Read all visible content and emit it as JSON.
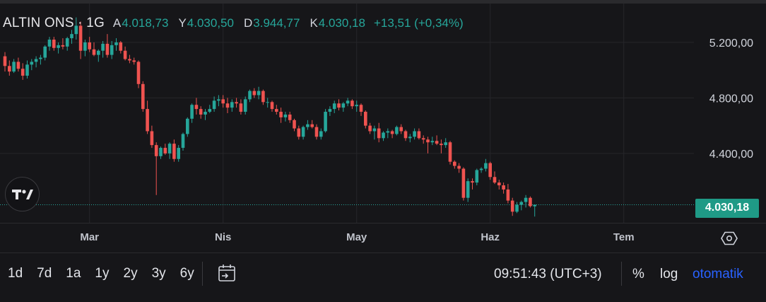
{
  "legend": {
    "symbol": "ALTIN ONS · 1G",
    "open_label": "A",
    "open_value": "4.018,73",
    "high_label": "Y",
    "high_value": "4.030,50",
    "low_label": "D",
    "low_value": "3.944,77",
    "close_label": "K",
    "close_value": "4.030,18",
    "change": "+13,51 (+0,34%)"
  },
  "price_badge": "4.030,18",
  "colors": {
    "up": "#26a69a",
    "down": "#ef5350",
    "badge": "#1f9a86",
    "auto": "#2962ff"
  },
  "chart_data": {
    "type": "candlestick",
    "ylim": [
      3900,
      5480
    ],
    "y_ticks": [
      {
        "value": 5200,
        "label": "5.200,00"
      },
      {
        "value": 4800,
        "label": "4.800,00"
      },
      {
        "value": 4400,
        "label": "4.400,00"
      }
    ],
    "x_ticks": [
      "Mar",
      "Nis",
      "May",
      "Haz",
      "Tem"
    ],
    "x_tick_index": [
      19,
      49,
      79,
      109,
      139
    ],
    "last_price": 4030.18,
    "ohlc": [
      [
        5100,
        5130,
        4990,
        5030
      ],
      [
        5030,
        5070,
        4960,
        4990
      ],
      [
        4990,
        5080,
        4980,
        5060
      ],
      [
        5060,
        5090,
        4990,
        5010
      ],
      [
        5010,
        5050,
        4930,
        4960
      ],
      [
        4960,
        5070,
        4940,
        5040
      ],
      [
        5040,
        5080,
        5000,
        5060
      ],
      [
        5060,
        5100,
        5020,
        5080
      ],
      [
        5080,
        5110,
        5040,
        5090
      ],
      [
        5090,
        5180,
        5070,
        5170
      ],
      [
        5170,
        5240,
        5140,
        5220
      ],
      [
        5220,
        5240,
        5140,
        5160
      ],
      [
        5160,
        5200,
        5120,
        5180
      ],
      [
        5180,
        5230,
        5150,
        5170
      ],
      [
        5170,
        5240,
        5140,
        5230
      ],
      [
        5230,
        5290,
        5190,
        5260
      ],
      [
        5260,
        5380,
        5220,
        5320
      ],
      [
        5320,
        5350,
        5080,
        5140
      ],
      [
        5140,
        5220,
        5100,
        5200
      ],
      [
        5200,
        5240,
        5130,
        5150
      ],
      [
        5150,
        5200,
        5100,
        5110
      ],
      [
        5110,
        5150,
        5060,
        5140
      ],
      [
        5140,
        5210,
        5090,
        5190
      ],
      [
        5190,
        5260,
        5090,
        5110
      ],
      [
        5110,
        5210,
        5080,
        5180
      ],
      [
        5180,
        5230,
        5140,
        5200
      ],
      [
        5200,
        5210,
        5120,
        5140
      ],
      [
        5140,
        5170,
        5070,
        5080
      ],
      [
        5080,
        5110,
        5050,
        5070
      ],
      [
        5070,
        5090,
        5040,
        5060
      ],
      [
        5060,
        5070,
        4870,
        4900
      ],
      [
        4900,
        4920,
        4700,
        4720
      ],
      [
        4720,
        4780,
        4540,
        4560
      ],
      [
        4560,
        4600,
        4440,
        4460
      ],
      [
        4460,
        4480,
        4100,
        4380
      ],
      [
        4380,
        4450,
        4360,
        4440
      ],
      [
        4440,
        4470,
        4390,
        4400
      ],
      [
        4400,
        4480,
        4360,
        4470
      ],
      [
        4470,
        4500,
        4340,
        4360
      ],
      [
        4360,
        4460,
        4340,
        4440
      ],
      [
        4440,
        4550,
        4420,
        4540
      ],
      [
        4540,
        4660,
        4520,
        4650
      ],
      [
        4650,
        4760,
        4620,
        4750
      ],
      [
        4750,
        4800,
        4680,
        4720
      ],
      [
        4720,
        4740,
        4650,
        4680
      ],
      [
        4680,
        4720,
        4640,
        4700
      ],
      [
        4700,
        4750,
        4690,
        4720
      ],
      [
        4720,
        4810,
        4700,
        4780
      ],
      [
        4780,
        4820,
        4740,
        4790
      ],
      [
        4790,
        4820,
        4730,
        4760
      ],
      [
        4760,
        4800,
        4690,
        4730
      ],
      [
        4730,
        4790,
        4700,
        4770
      ],
      [
        4770,
        4800,
        4730,
        4760
      ],
      [
        4760,
        4790,
        4680,
        4700
      ],
      [
        4700,
        4810,
        4680,
        4790
      ],
      [
        4790,
        4860,
        4770,
        4850
      ],
      [
        4850,
        4870,
        4800,
        4820
      ],
      [
        4820,
        4880,
        4790,
        4850
      ],
      [
        4850,
        4860,
        4750,
        4770
      ],
      [
        4770,
        4800,
        4730,
        4770
      ],
      [
        4770,
        4780,
        4700,
        4720
      ],
      [
        4720,
        4750,
        4680,
        4700
      ],
      [
        4700,
        4730,
        4620,
        4660
      ],
      [
        4660,
        4700,
        4630,
        4680
      ],
      [
        4680,
        4700,
        4620,
        4640
      ],
      [
        4640,
        4650,
        4560,
        4580
      ],
      [
        4580,
        4600,
        4500,
        4520
      ],
      [
        4520,
        4600,
        4500,
        4590
      ],
      [
        4590,
        4640,
        4570,
        4610
      ],
      [
        4610,
        4640,
        4580,
        4590
      ],
      [
        4590,
        4610,
        4500,
        4520
      ],
      [
        4520,
        4580,
        4500,
        4560
      ],
      [
        4560,
        4720,
        4550,
        4700
      ],
      [
        4700,
        4740,
        4670,
        4720
      ],
      [
        4720,
        4780,
        4690,
        4760
      ],
      [
        4760,
        4790,
        4710,
        4730
      ],
      [
        4730,
        4770,
        4700,
        4760
      ],
      [
        4760,
        4800,
        4740,
        4780
      ],
      [
        4780,
        4790,
        4720,
        4740
      ],
      [
        4740,
        4780,
        4700,
        4750
      ],
      [
        4750,
        4760,
        4670,
        4700
      ],
      [
        4700,
        4710,
        4580,
        4600
      ],
      [
        4600,
        4620,
        4540,
        4560
      ],
      [
        4560,
        4600,
        4500,
        4580
      ],
      [
        4580,
        4620,
        4480,
        4510
      ],
      [
        4510,
        4560,
        4490,
        4550
      ],
      [
        4550,
        4580,
        4510,
        4560
      ],
      [
        4560,
        4570,
        4510,
        4540
      ],
      [
        4540,
        4600,
        4530,
        4590
      ],
      [
        4590,
        4610,
        4540,
        4560
      ],
      [
        4560,
        4570,
        4490,
        4510
      ],
      [
        4510,
        4540,
        4480,
        4520
      ],
      [
        4520,
        4580,
        4500,
        4560
      ],
      [
        4560,
        4580,
        4500,
        4510
      ],
      [
        4510,
        4530,
        4470,
        4500
      ],
      [
        4500,
        4520,
        4400,
        4480
      ],
      [
        4480,
        4520,
        4460,
        4490
      ],
      [
        4490,
        4530,
        4460,
        4470
      ],
      [
        4470,
        4500,
        4400,
        4460
      ],
      [
        4460,
        4510,
        4440,
        4480
      ],
      [
        4480,
        4490,
        4320,
        4340
      ],
      [
        4340,
        4350,
        4290,
        4310
      ],
      [
        4310,
        4330,
        4260,
        4290
      ],
      [
        4290,
        4300,
        4060,
        4080
      ],
      [
        4080,
        4220,
        4050,
        4200
      ],
      [
        4200,
        4220,
        4140,
        4190
      ],
      [
        4190,
        4290,
        4170,
        4280
      ],
      [
        4280,
        4300,
        4260,
        4290
      ],
      [
        4290,
        4360,
        4270,
        4330
      ],
      [
        4330,
        4340,
        4210,
        4230
      ],
      [
        4230,
        4270,
        4180,
        4190
      ],
      [
        4190,
        4210,
        4140,
        4170
      ],
      [
        4170,
        4190,
        4110,
        4140
      ],
      [
        4140,
        4180,
        4040,
        4060
      ],
      [
        4060,
        4080,
        3950,
        3980
      ],
      [
        3980,
        4050,
        3970,
        4030
      ],
      [
        4030,
        4060,
        3990,
        4050
      ],
      [
        4050,
        4100,
        4010,
        4080
      ],
      [
        4080,
        4090,
        4010,
        4020
      ],
      [
        4018.73,
        4030.5,
        3944.77,
        4030.18
      ]
    ]
  },
  "xaxis_labels": [
    "Mar",
    "Nis",
    "May",
    "Haz",
    "Tem"
  ],
  "ranges": [
    "1d",
    "7d",
    "1a",
    "1y",
    "2y",
    "3y",
    "6y"
  ],
  "clock": "09:51:43 (UTC+3)",
  "scale_buttons": {
    "percent": "%",
    "log": "log",
    "auto": "otomatik"
  }
}
